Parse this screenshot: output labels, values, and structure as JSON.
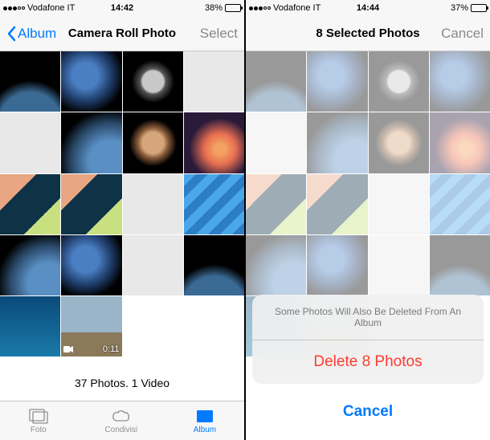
{
  "left": {
    "status": {
      "carrier": "Vodafone IT",
      "time": "14:42",
      "battery_percent": "38%"
    },
    "nav": {
      "back_label": "Album",
      "title": "Camera Roll Photo",
      "select_label": "Select"
    },
    "grid": {
      "video_duration": "0:11"
    },
    "count_label": "37 Photos. 1 Video",
    "tabs": {
      "foto": "Foto",
      "condivisi": "Condivisi",
      "album": "Album"
    }
  },
  "right": {
    "status": {
      "carrier": "Vodafone IT",
      "time": "14:44",
      "battery_percent": "37%"
    },
    "nav": {
      "title": "8 Selected Photos",
      "cancel_label": "Cancel"
    },
    "action_sheet": {
      "message_prefix": "Some Photos Will Also Be Deleted From ",
      "message_album": "An Album",
      "delete_label": "Delete 8 Photos",
      "cancel_label": "Cancel"
    }
  }
}
